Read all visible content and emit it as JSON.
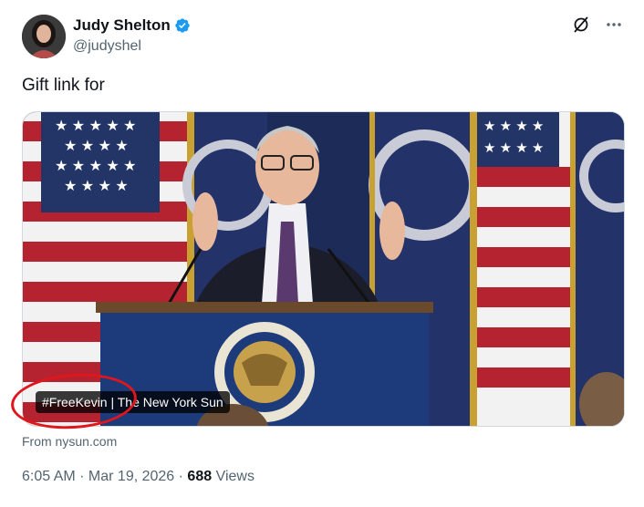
{
  "author": {
    "display_name": "Judy Shelton",
    "handle": "@judyshel",
    "verified": true,
    "avatar_icon": "profile-photo"
  },
  "actions": {
    "grok_icon": "slashed-circle-icon",
    "more_icon": "more-horizontal-icon"
  },
  "tweet": {
    "text": "Gift link for"
  },
  "card": {
    "label": "#FreeKevin | The New York Sun",
    "source": "From nysun.com",
    "annotation_color": "#e0161d"
  },
  "meta": {
    "time": "6:05 AM",
    "sep1": " · ",
    "date": "Mar 19, 2026",
    "sep2": " · ",
    "views_count": "688",
    "views_label": " Views"
  },
  "colors": {
    "verified_blue": "#1d9bf0",
    "muted_text": "#536471"
  }
}
